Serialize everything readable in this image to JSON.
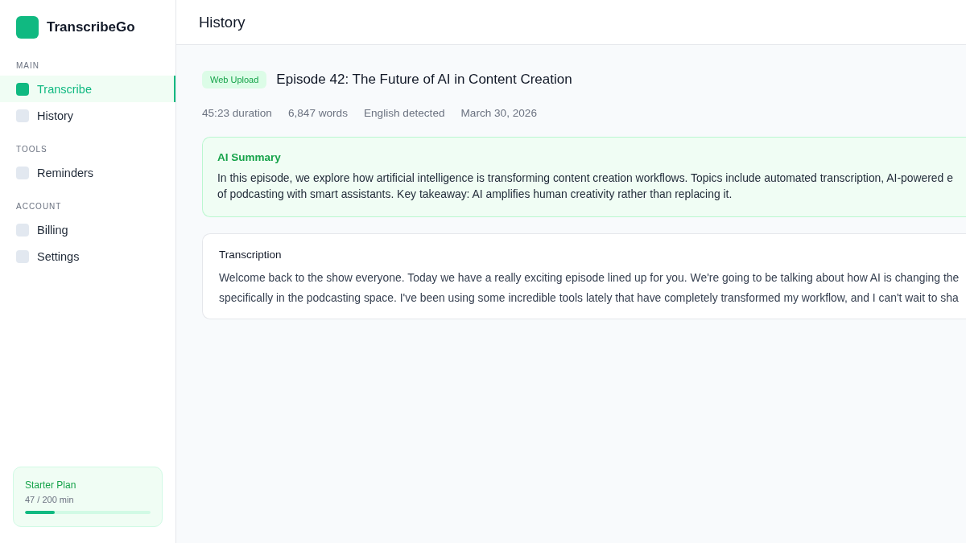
{
  "sidebar": {
    "brand": "TranscribeGo",
    "sections": [
      {
        "label": "MAIN",
        "items": [
          {
            "label": "Transcribe",
            "selected": true
          },
          {
            "label": "History",
            "selected": false
          }
        ]
      },
      {
        "label": "TOOLS",
        "items": [
          {
            "label": "Reminders",
            "selected": false
          }
        ]
      },
      {
        "label": "ACCOUNT",
        "items": [
          {
            "label": "Billing",
            "selected": false
          },
          {
            "label": "Settings",
            "selected": false
          }
        ]
      }
    ],
    "plan": {
      "name": "Starter Plan",
      "usage": "47 / 200 min",
      "level": 0.235
    }
  },
  "header": {
    "title": "History"
  },
  "episode": {
    "badge": "Web Upload",
    "title": "Episode 42: The Future of AI in Content Creation",
    "meta": [
      "45:23 duration",
      "6,847 words",
      "English detected",
      "March 30, 2026"
    ]
  },
  "summary": {
    "heading": "AI Summary",
    "lines": [
      "In this episode, we explore how artificial intelligence is transforming content creation workflows. Topics include automated transcription, AI-powered e",
      "of podcasting with smart assistants. Key takeaway: AI amplifies human creativity rather than replacing it."
    ]
  },
  "transcription": {
    "heading": "Transcription",
    "lines": [
      "Welcome back to the show everyone. Today we have a really exciting episode lined up for you. We're going to be talking about how AI is changing the",
      "specifically in the podcasting space. I've been using some incredible tools lately that have completely transformed my workflow, and I can't wait to sha"
    ]
  }
}
